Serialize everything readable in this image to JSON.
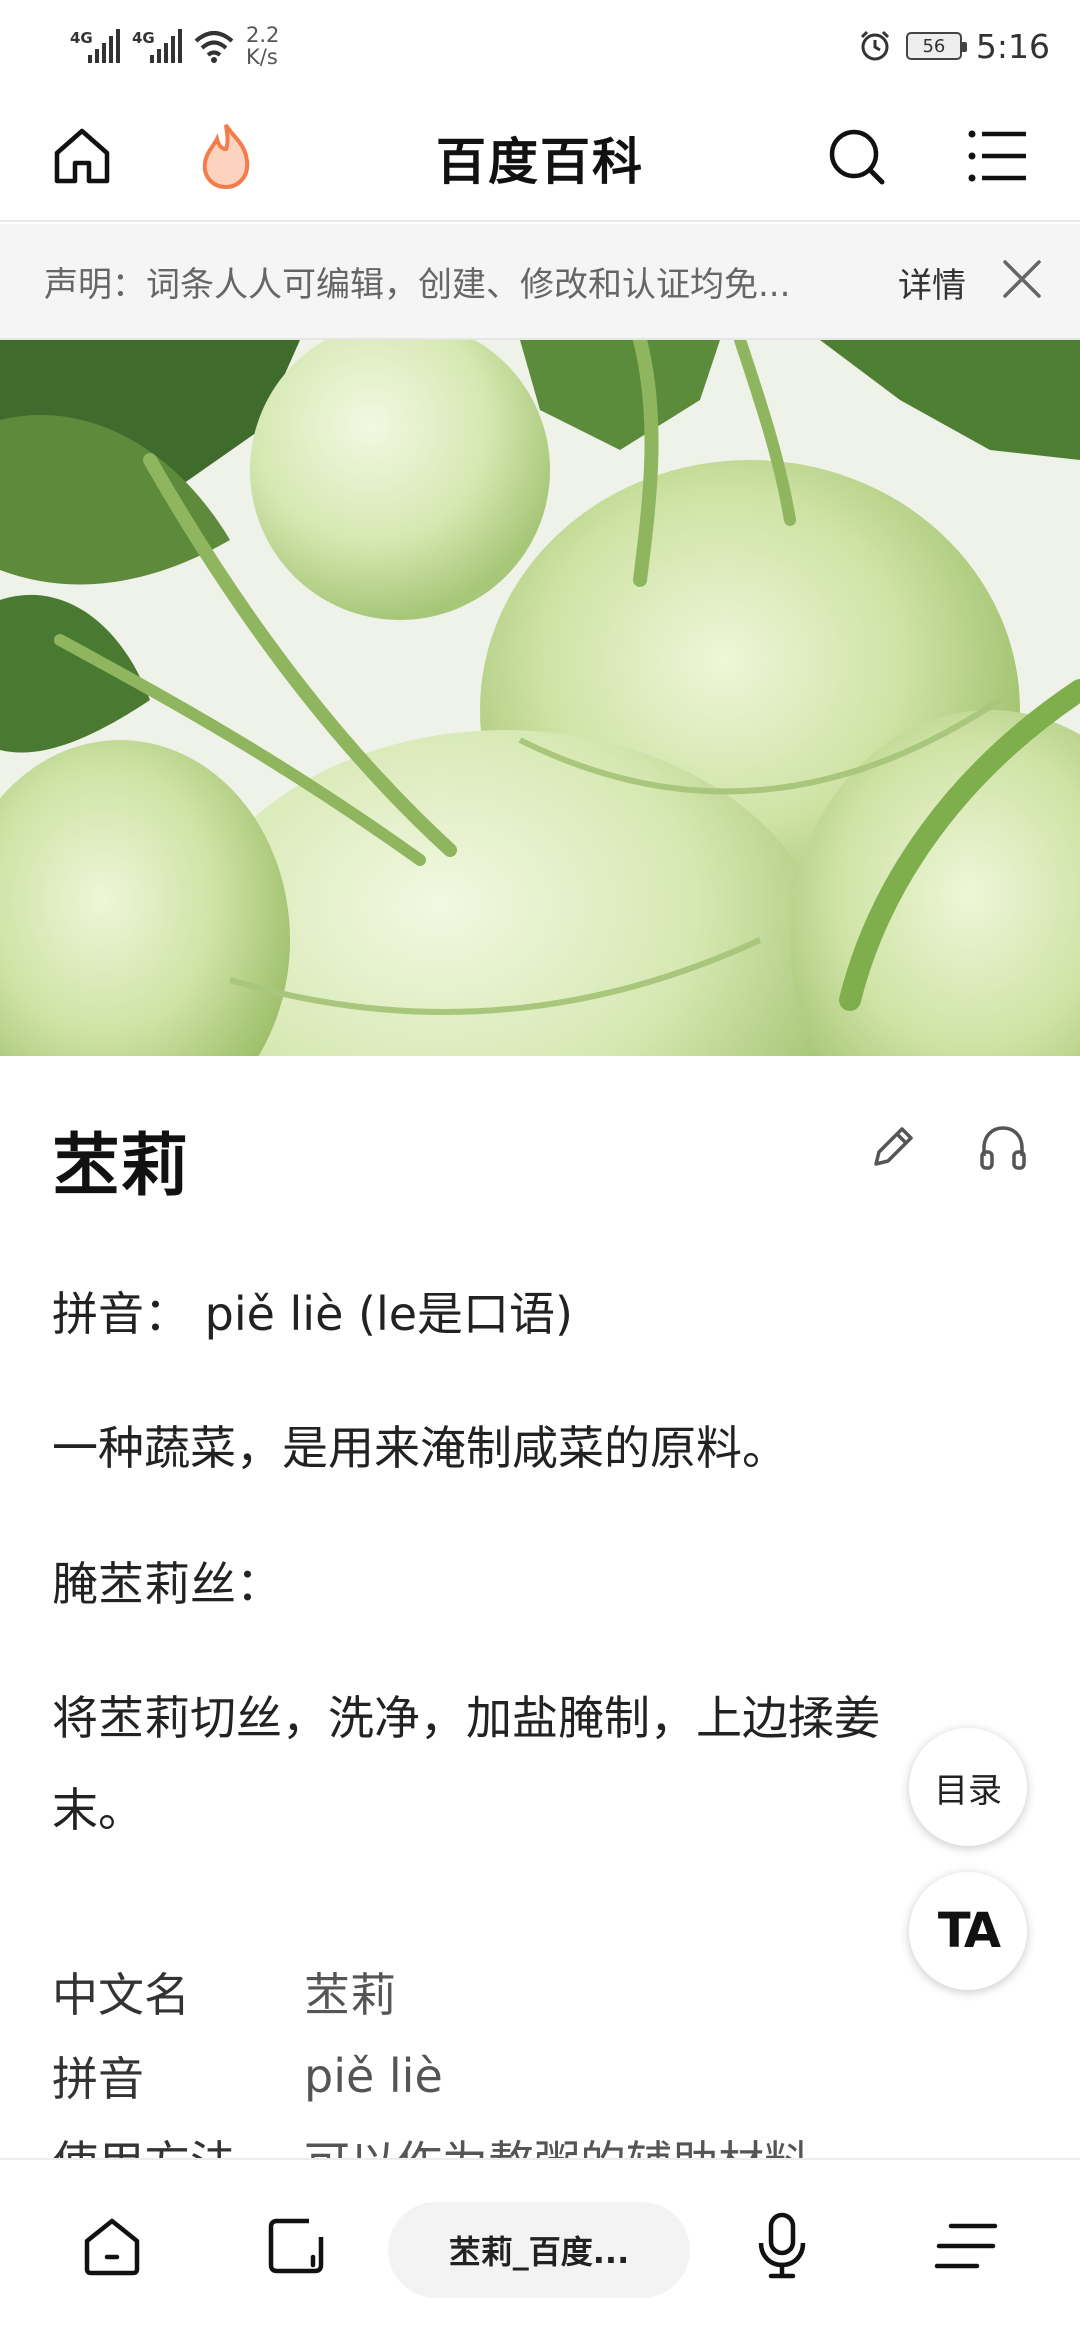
{
  "status_bar": {
    "net_1": "4G",
    "net_2": "4G",
    "speed_value": "2.2",
    "speed_unit": "K/s",
    "battery": "56",
    "time": "5:16",
    "icons": [
      "signal-icon",
      "signal-icon",
      "wifi-icon",
      "alarm-icon",
      "battery-icon"
    ]
  },
  "navbar": {
    "title": "百度百科",
    "icons": [
      "home-icon",
      "hot-flame-icon",
      "search-icon",
      "menu-icon"
    ],
    "accent_color": "#f47c4a"
  },
  "notice": {
    "text": "声明：词条人人可编辑，创建、修改和认证均免...",
    "detail": "详情"
  },
  "article": {
    "title": "苤莉",
    "pinyin_label": "拼音：",
    "pinyin_value": "piě liè (le是口语)",
    "definition": "一种蔬菜，是用来淹制咸菜的原料。",
    "section_heading": "腌苤莉丝：",
    "method_line1": "将苤莉切丝，洗净，加盐腌制，上边揉姜",
    "method_line2": "末。"
  },
  "infobox": [
    {
      "key": "中文名",
      "value": "苤莉"
    },
    {
      "key": "拼音",
      "value": "piě liè"
    },
    {
      "key": "使用方法",
      "value": "可以作为熬粥的辅助材料"
    }
  ],
  "floating": {
    "toc": "目录",
    "font": "TA"
  },
  "bottom_bar": {
    "tab_label": "苤莉_百度...",
    "icons": [
      "home-icon",
      "tabs-icon",
      "microphone-icon",
      "menu-icon"
    ]
  }
}
